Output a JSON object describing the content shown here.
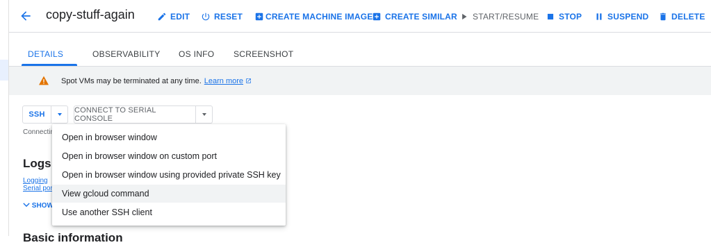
{
  "header": {
    "title": "copy-stuff-again",
    "actions": {
      "edit": "EDIT",
      "reset": "RESET",
      "create_image": "CREATE MACHINE IMAGE",
      "create_similar": "CREATE SIMILAR",
      "start_resume": "START/RESUME",
      "stop": "STOP",
      "suspend": "SUSPEND",
      "delete": "DELETE"
    }
  },
  "tabs": [
    {
      "label": "DETAILS",
      "active": true
    },
    {
      "label": "OBSERVABILITY",
      "active": false
    },
    {
      "label": "OS INFO",
      "active": false
    },
    {
      "label": "SCREENSHOT",
      "active": false
    }
  ],
  "banner": {
    "text": "Spot VMs may be terminated at any time.",
    "link": "Learn more"
  },
  "connect": {
    "ssh_label": "SSH",
    "serial_label": "CONNECT TO SERIAL CONSOLE",
    "status_text": "Connecting"
  },
  "ssh_menu": {
    "items": [
      "Open in browser window",
      "Open in browser window on custom port",
      "Open in browser window using provided private SSH key",
      "View gcloud command",
      "Use another SSH client"
    ],
    "hovered_index": 3
  },
  "logs": {
    "title": "Logs",
    "links": [
      "Logging",
      "Serial port"
    ],
    "show_more": "SHOW"
  },
  "basic_info": {
    "title": "Basic information"
  },
  "colors": {
    "accent": "#1a73e8",
    "warning": "#e37400",
    "banner_bg": "#f1f3f4",
    "text": "#202124",
    "muted": "#5f6368"
  }
}
